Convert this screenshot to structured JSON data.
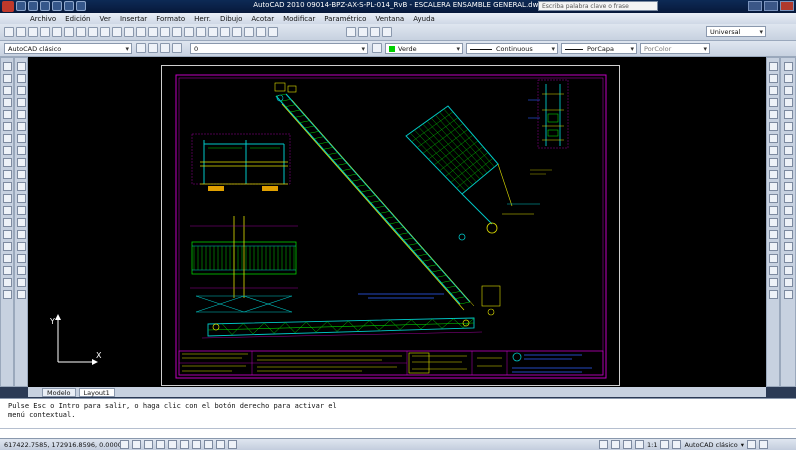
{
  "window": {
    "title": "AutoCAD 2010   09014-BPZ-AX-S-PL-014_RvB - ESCALERA ENSAMBLE GENERAL.dwg",
    "search_placeholder": "Escriba palabra clave o frase"
  },
  "menu": [
    "Archivo",
    "Edición",
    "Ver",
    "Insertar",
    "Formato",
    "Herr.",
    "Dibujo",
    "Acotar",
    "Modificar",
    "Paramétrico",
    "Ventana",
    "Ayuda"
  ],
  "toolbar": {
    "workspace": "AutoCAD clásico",
    "layer": "0",
    "text_style": "Universal",
    "color": "Verde",
    "linetype": "Continuous",
    "lineweight": "PorCapa",
    "plotstyle": "PorColor"
  },
  "tabs": [
    "Modelo",
    "Layout1"
  ],
  "command": {
    "line1": "Pulse Esc o Intro para salir, o haga clic con el botón derecho para activar el",
    "line2": "menú contextual."
  },
  "status": {
    "coords": "617422.7585, 172916.8596, 0.0000",
    "scale": "1:1",
    "workspace": "AutoCAD clásico"
  },
  "ucs": {
    "x_label": "X",
    "y_label": "Y"
  },
  "colors": {
    "canvas": "#000000",
    "cad_magenta": "#c000c0",
    "cad_yellow": "#e0e000",
    "cad_green": "#00d000",
    "cad_cyan": "#00c8c8",
    "cad_blue": "#3060ff"
  }
}
